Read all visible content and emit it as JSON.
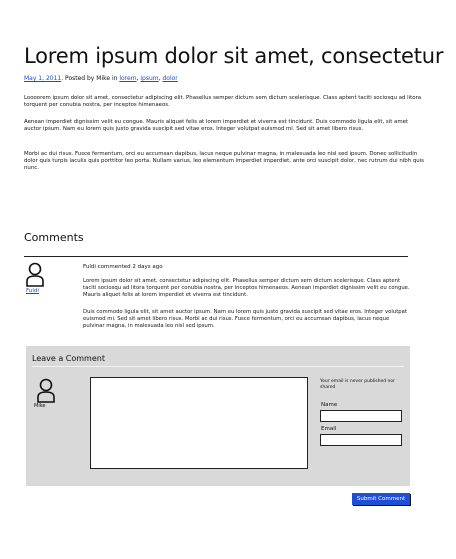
{
  "post": {
    "title": "Lorem ipsum dolor sit amet, consectetur adi",
    "meta": {
      "date": "May 1, 2011",
      "posted_by_text": ". Posted by Mike in ",
      "tag1": "lorem",
      "sep1": ", ",
      "tag2": "ipsum",
      "sep2": ", ",
      "tag3": "dolor"
    },
    "paragraphs": [
      "Loooorem ipsum dolor sit amet, consectetur adipiscing elit. Phasellus semper dictum sem dictum scelerisque. Class aptent taciti sociosqu ad litora torquent per conubia nostra, per inceptos himenaeos.",
      "Aenean imperdiet dignissim velit eu congue. Mauris aliquet felis at lorem imperdiet et viverra est tincidunt. Duis commodo ligula elit, sit amet auctor ipsum. Nam eu lorem quis justo gravida suscipit sed vitae eros. Integer volutpat euismod mi. Sed sit amet libero risus.",
      "Morbi ac dui risus. Fusce fermentum, orci eu accumsan dapibus, lacus neque pulvinar magna, in malesuada leo nisl sed ipsum. Donec sollicitudin dolor quis turpis iaculis quis porttitor leo porta. Nullam varius, leo elementum imperdiet imperdiet, ante orci suscipit dolor, nec rutrum dui nibh quis nunc."
    ]
  },
  "comments": {
    "heading": "Comments",
    "items": [
      {
        "author": "Fuldi",
        "meta": "Fuldi commented 2 days ago",
        "paragraphs": [
          "Lorem ipsum dolor sit amet, consectetur adipiscing elit. Phasellus semper dictum sem dictum scelerisque. Class aptent taciti sociosqu ad litora torquent per conubia nostra, per inceptos himenaeos. Aenean imperdiet dignissim velit eu congue. Mauris aliquet felis at lorem imperdiet et viverra est tincidunt.",
          "Duis commodo ligula elit, sit amet auctor ipsum. Nam eu lorem quis justo gravida suscipit sed vitae eros. Integer volutpat euismod mi. Sed sit amet libero risus. Morbi ac dui risus. Fusce fermentum, orci eu accumsan dapibus, lacus neque pulvinar magna, in malesuada leo nisl sed ipsum."
        ]
      }
    ]
  },
  "leave_comment": {
    "title": "Leave a Comment",
    "user": "Mike",
    "notice": "Your email is never published nor shared",
    "name_label": "Name",
    "email_label": "Email",
    "submit_label": "Submit Comment"
  },
  "icons": {
    "avatar": "user-avatar-icon"
  },
  "colors": {
    "link": "#1a4bd6",
    "button": "#1e4fd6",
    "panel": "#d9d9d9"
  }
}
